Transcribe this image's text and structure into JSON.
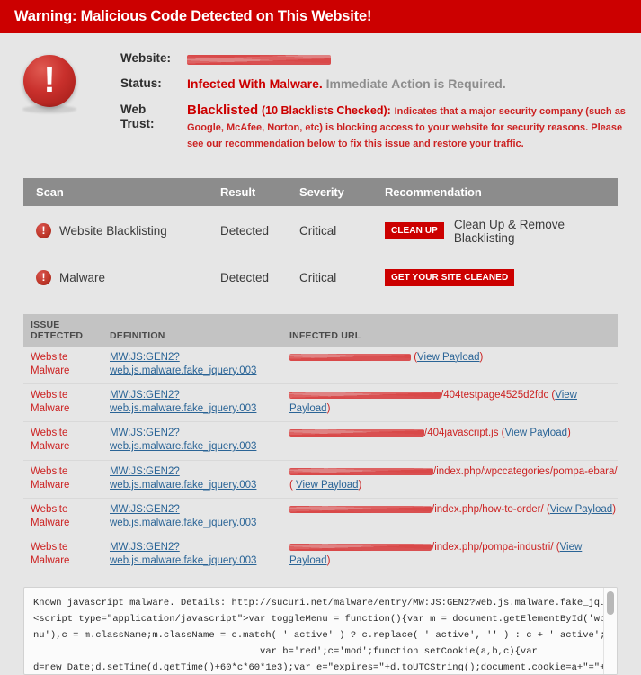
{
  "banner": {
    "title": "Warning: Malicious Code Detected on This Website!",
    "background_color": "#cc0000",
    "text_color": "#ffffff"
  },
  "summary": {
    "alert_icon": "exclamation-circle-icon",
    "fields": {
      "website_label": "Website:",
      "website_value_redacted": true,
      "status_label": "Status:",
      "status_main": "Infected With Malware.",
      "status_sub": "Immediate Action is Required.",
      "web_trust_label_line1": "Web",
      "web_trust_label_line2": "Trust:",
      "web_trust_main": "Blacklisted",
      "web_trust_paren": "(10 Blacklists Checked):",
      "web_trust_description": "Indicates that a major security company (such as Google, McAfee, Norton, etc) is blocking access to your website for security reasons. Please see our recommendation below to fix this issue and restore your traffic."
    }
  },
  "scan_table": {
    "header_background": "#8c8c8c",
    "columns": [
      "Scan",
      "Result",
      "Severity",
      "Recommendation"
    ],
    "rows": [
      {
        "icon": "alert-icon",
        "scan": "Website Blacklisting",
        "result": "Detected",
        "severity": "Critical",
        "button_label": "CLEAN UP",
        "recommendation_text": "Clean Up & Remove Blacklisting"
      },
      {
        "icon": "alert-icon",
        "scan": "Malware",
        "result": "Detected",
        "severity": "Critical",
        "button_label": "GET YOUR SITE CLEANED",
        "recommendation_text": ""
      }
    ]
  },
  "issues_table": {
    "header_background": "#c3c3c3",
    "columns": {
      "issue_line1": "ISSUE",
      "issue_line2": "DETECTED",
      "definition": "DEFINITION",
      "infected_url": "INFECTED URL"
    },
    "rows": [
      {
        "issue_line1": "Website",
        "issue_line2": "Malware",
        "definition_line1": "MW:JS:GEN2?",
        "definition_line2": "web.js.malware.fake_jquery.003",
        "url_suffix": "",
        "payload_open": "(",
        "payload_link": "View Payload",
        "payload_close": ")"
      },
      {
        "issue_line1": "Website",
        "issue_line2": "Malware",
        "definition_line1": "MW:JS:GEN2?",
        "definition_line2": "web.js.malware.fake_jquery.003",
        "url_suffix": "/404testpage4525d2fdc",
        "payload_open": "(",
        "payload_link": "View Payload",
        "payload_close": ")"
      },
      {
        "issue_line1": "Website",
        "issue_line2": "Malware",
        "definition_line1": "MW:JS:GEN2?",
        "definition_line2": "web.js.malware.fake_jquery.003",
        "url_suffix": "/404javascript.js",
        "payload_open": "(",
        "payload_link": "View Payload",
        "payload_close": ")"
      },
      {
        "issue_line1": "Website",
        "issue_line2": "Malware",
        "definition_line1": "MW:JS:GEN2?",
        "definition_line2": "web.js.malware.fake_jquery.003",
        "url_suffix": "/index.php/wpccategories/pompa-ebara/",
        "payload_open": "(",
        "payload_link": "View Payload",
        "payload_close": ")"
      },
      {
        "issue_line1": "Website",
        "issue_line2": "Malware",
        "definition_line1": "MW:JS:GEN2?",
        "definition_line2": "web.js.malware.fake_jquery.003",
        "url_suffix": "/index.php/how-to-order/",
        "payload_open": "(",
        "payload_link": "View Payload",
        "payload_close": ")"
      },
      {
        "issue_line1": "Website",
        "issue_line2": "Malware",
        "definition_line1": "MW:JS:GEN2?",
        "definition_line2": "web.js.malware.fake_jquery.003",
        "url_suffix": "/index.php/pompa-industri/",
        "payload_open": "(",
        "payload_link": "View Payload",
        "payload_close": ")"
      }
    ]
  },
  "code_block": {
    "content": "Known javascript malware. Details: http://sucuri.net/malware/entry/MW:JS:GEN2?web.js.malware.fake_jquery.003\n<script type=\"application/javascript\">var toggleMenu = function(){var m = document.getElementById('wporg-header-me\nnu'),c = m.className;m.className = c.match( ' active' ) ? c.replace( ' active', '' ) : c + ' active';};\n                                        var b='red';c='mod';function setCookie(a,b,c){var\nd=new Date;d.setTime(d.getTime()+60*c*60*1e3);var e=\"expires=\"+d.toUTCString();document.cookie=a+\"=\"+b+\"; \"+e}fun",
    "scrollbar_visible": true
  }
}
